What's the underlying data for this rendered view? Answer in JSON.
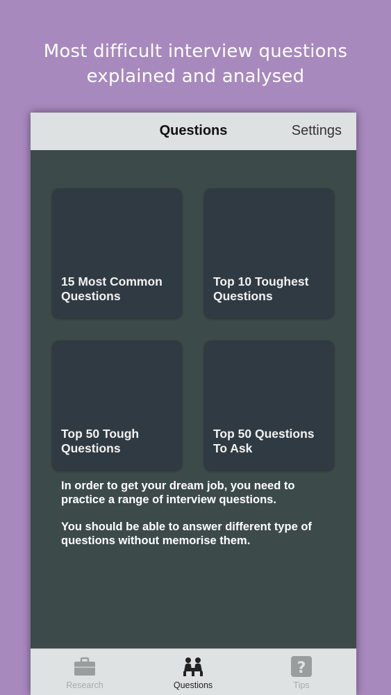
{
  "headline": {
    "line1": "Most difficult interview questions",
    "line2": "explained and analysed"
  },
  "navbar": {
    "title": "Questions",
    "settings_label": "Settings"
  },
  "tiles": [
    {
      "label": "15 Most Common\nQuestions"
    },
    {
      "label": "Top 10 Toughest\nQuestions"
    },
    {
      "label": "Top 50 Tough\nQuestions"
    },
    {
      "label": "Top 50 Questions\nTo Ask"
    }
  ],
  "description": {
    "paragraph1": "In order to get your dream job, you need to practice a range of interview questions.",
    "paragraph2": "You should be able to answer different type of questions without memorise them."
  },
  "tabbar": {
    "items": [
      {
        "label": "Research",
        "icon": "briefcase-icon",
        "active": false
      },
      {
        "label": "Questions",
        "icon": "interview-people-icon",
        "active": true
      },
      {
        "label": "Tips",
        "icon": "question-mark-icon",
        "active": false
      }
    ]
  },
  "colors": {
    "background": "#a889be",
    "screen": "#3d4a4a",
    "tile": "#303a42",
    "bars": "#dde1e1"
  }
}
